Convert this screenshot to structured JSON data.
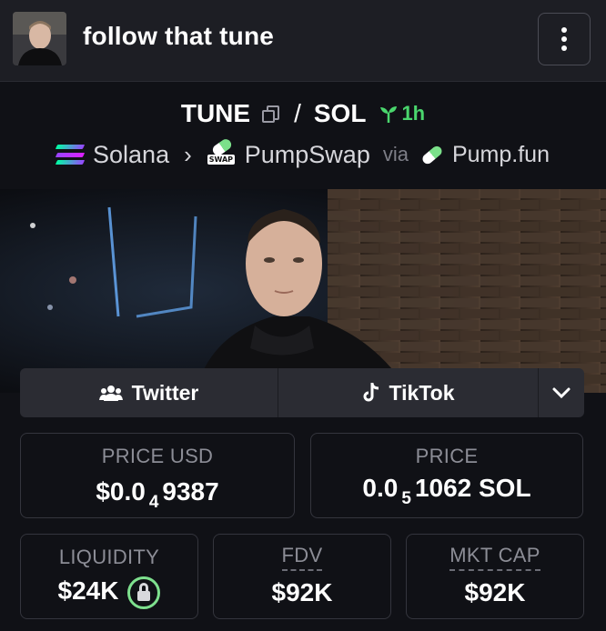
{
  "header": {
    "title": "follow that tune",
    "menu_icon": "more-vertical-icon"
  },
  "pair": {
    "base": "TUNE",
    "separator": "/",
    "quote": "SOL",
    "age": "1h",
    "age_icon": "seedling-icon",
    "age_color": "#4ad66d"
  },
  "chain": {
    "network": "Solana",
    "dex": "PumpSwap",
    "dex_badge": "SWAP",
    "via_label": "via",
    "source": "Pump.fun"
  },
  "social": {
    "twitter_label": "Twitter",
    "tiktok_label": "TikTok",
    "more_icon": "chevron-down-icon"
  },
  "stats": {
    "price_usd": {
      "label": "PRICE USD",
      "prefix": "$0.0",
      "zeros": "4",
      "digits": "9387"
    },
    "price_native": {
      "label": "PRICE",
      "prefix": "0.0",
      "zeros": "5",
      "digits": "1062 SOL"
    },
    "liquidity": {
      "label": "LIQUIDITY",
      "value": "$24K",
      "lock_color": "#7ee08e"
    },
    "fdv": {
      "label": "FDV",
      "value": "$92K"
    },
    "mkt_cap": {
      "label": "MKT CAP",
      "value": "$92K"
    }
  }
}
